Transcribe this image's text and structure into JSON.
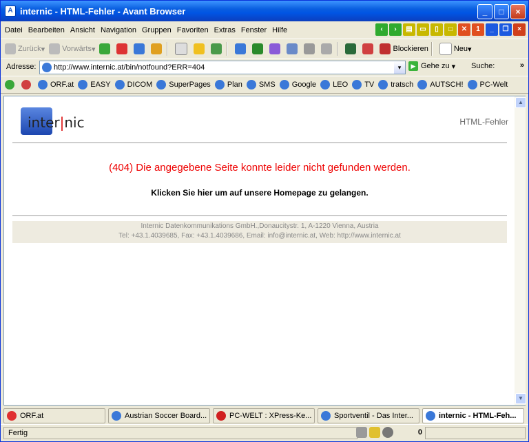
{
  "window": {
    "title": "internic - HTML-Fehler - Avant Browser"
  },
  "menu": [
    "Datei",
    "Bearbeiten",
    "Ansicht",
    "Navigation",
    "Gruppen",
    "Favoriten",
    "Extras",
    "Fenster",
    "Hilfe"
  ],
  "toolbar": {
    "back": "Zurück",
    "forward": "Vorwärts",
    "block": "Blockieren",
    "new": "Neu"
  },
  "address": {
    "label": "Adresse:",
    "url": "http://www.internic.at/bin/notfound?ERR=404",
    "go": "Gehe zu",
    "search": "Suche:"
  },
  "links": [
    "ORF.at",
    "EASY",
    "DICOM",
    "SuperPages",
    "Plan",
    "SMS",
    "Google",
    "LEO",
    "TV",
    "tratsch",
    "AUTSCH!",
    "PC-Welt"
  ],
  "page": {
    "logo": "inter|nic",
    "header_right": "HTML-Fehler",
    "error": "(404) Die angegebene Seite konnte leider nicht gefunden werden.",
    "click": "Klicken Sie hier um auf unsere Homepage zu gelangen.",
    "footer_line1": "Internic Datenkommunikations GmbH.,Donaucitystr. 1, A-1220 Vienna, Austria",
    "footer_line2": "Tel: +43.1.4039685, Fax: +43.1.4039686, Email: info@internic.at, Web: http://www.internic.at"
  },
  "tabs": [
    {
      "label": "ORF.at",
      "color": "#e03030"
    },
    {
      "label": "Austrian Soccer Board...",
      "color": "#3a78d8"
    },
    {
      "label": "PC-WELT : XPress-Ke...",
      "color": "#d02020"
    },
    {
      "label": "Sportventil - Das Inter...",
      "color": "#3a78d8"
    },
    {
      "label": "internic - HTML-Feh...",
      "color": "#3a78d8"
    }
  ],
  "status": {
    "text": "Fertig",
    "count": "0"
  }
}
